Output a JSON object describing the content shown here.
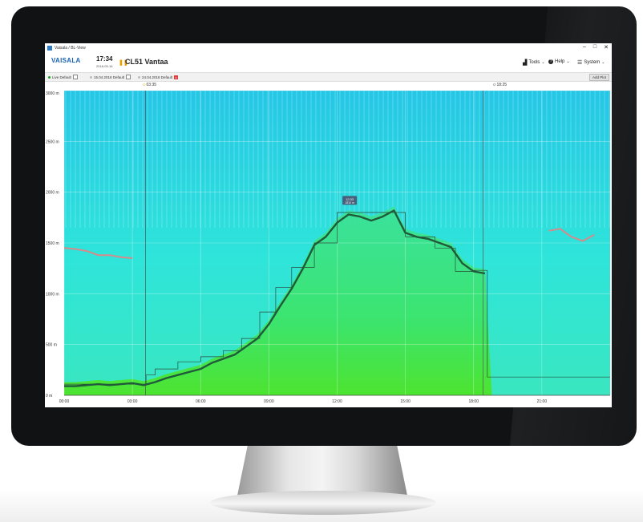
{
  "window": {
    "title": "Vaisala / BL-View"
  },
  "header": {
    "logo": "VAISALA",
    "time": "17:34",
    "date": "2018-05-16",
    "site": "CL51 Vantaa",
    "menus": [
      {
        "label": "Tools",
        "icon": "toolbox-icon"
      },
      {
        "label": "Help",
        "icon": "help-icon"
      },
      {
        "label": "System",
        "icon": "settings-icon"
      }
    ]
  },
  "tabs": [
    {
      "label": "Live Default",
      "active": false
    },
    {
      "label": "15.04.2018 Default",
      "active": false
    },
    {
      "label": "24.04.2018 Default",
      "active": true
    }
  ],
  "add_plot_label": "Add Plot",
  "sun_events": [
    {
      "label": "03:35",
      "icon": "sunrise-icon"
    },
    {
      "label": "18:25",
      "icon": "sunset-icon"
    }
  ],
  "chart_data": {
    "type": "heatmap",
    "x_ticks": [
      "00:00",
      "03:00",
      "06:00",
      "09:00",
      "12:00",
      "15:00",
      "18:00",
      "21:00"
    ],
    "y_ticks": [
      "0 m",
      "500 m",
      "1000 m",
      "1500 m",
      "2000 m",
      "2500 m",
      "3000 m"
    ],
    "xlim": [
      0,
      24
    ],
    "ylim": [
      0,
      3000
    ],
    "grid": true,
    "colors": {
      "background_top": "#25c9e0",
      "background_mid": "#2ee6d6",
      "boundary_layer": "#30e070",
      "surface": "#3ee630",
      "mixing_layer_line": "#1f5a3a"
    },
    "sunrise_hour": 3.58,
    "sunset_hour": 18.42,
    "tooltip": {
      "time": "12:33",
      "value": "1810 m"
    },
    "mixing_layer_height": {
      "x": [
        0,
        0.5,
        1,
        1.5,
        2,
        2.5,
        3,
        3.5,
        4,
        4.5,
        5,
        5.5,
        6,
        6.5,
        7,
        7.5,
        8,
        8.5,
        9,
        9.5,
        10,
        10.5,
        11,
        11.5,
        12,
        12.5,
        13,
        13.5,
        14,
        14.5,
        15,
        15.5,
        16,
        16.5,
        17,
        17.5,
        18,
        18.5
      ],
      "y": [
        90,
        90,
        100,
        110,
        100,
        110,
        120,
        100,
        130,
        170,
        200,
        230,
        260,
        320,
        360,
        400,
        480,
        560,
        700,
        880,
        1050,
        1250,
        1480,
        1560,
        1700,
        1780,
        1760,
        1720,
        1760,
        1820,
        1600,
        1560,
        1540,
        1500,
        1460,
        1300,
        1220,
        1200
      ]
    },
    "upper_layer_left": {
      "x": [
        0,
        0.5,
        1,
        1.5,
        2,
        2.5,
        3
      ],
      "y": [
        1450,
        1440,
        1420,
        1380,
        1380,
        1360,
        1350
      ]
    },
    "upper_layer_right": {
      "x": [
        21.3,
        21.8,
        22.3,
        22.8,
        23.3
      ],
      "y": [
        1620,
        1640,
        1560,
        1520,
        1580
      ]
    },
    "step_line": {
      "x": [
        0,
        3.6,
        3.6,
        4.0,
        4.0,
        5.0,
        5.0,
        6.0,
        6.0,
        7.0,
        7.0,
        7.8,
        7.8,
        8.6,
        8.6,
        9.3,
        9.3,
        10.0,
        10.0,
        11.0,
        11.0,
        12.0,
        12.0,
        15.0,
        15.0,
        16.3,
        16.3,
        17.2,
        17.2,
        18.0,
        18.0,
        18.6,
        18.6,
        24
      ],
      "y": [
        110,
        110,
        200,
        200,
        260,
        260,
        330,
        330,
        380,
        380,
        440,
        440,
        560,
        560,
        820,
        820,
        1060,
        1060,
        1260,
        1260,
        1500,
        1500,
        1800,
        1800,
        1560,
        1560,
        1450,
        1450,
        1220,
        1220,
        1230,
        1230,
        180,
        180
      ]
    }
  }
}
